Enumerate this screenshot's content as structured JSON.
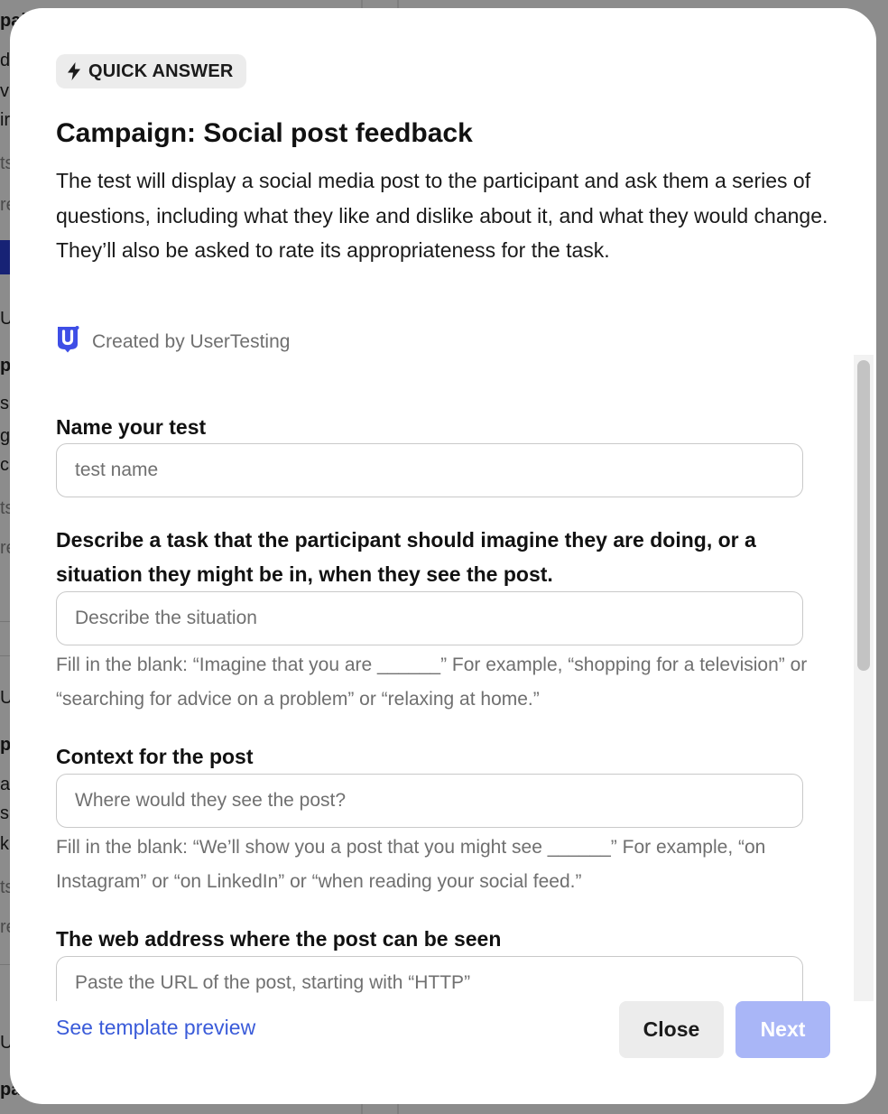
{
  "background": {
    "fragments": [
      "pai",
      "di",
      "v",
      "ir",
      "ts",
      "re",
      "U",
      "p",
      "sh",
      "g",
      "c",
      "ts",
      "re",
      "U",
      "p",
      "a",
      "sk",
      "k",
      "ts",
      "re",
      "U",
      "pa"
    ]
  },
  "modal": {
    "badge": {
      "icon": "lightning-bolt-icon",
      "label": "QUICK ANSWER"
    },
    "title": "Campaign: Social post feedback",
    "description": "The test will display a social media post to the participant and ask them a series of questions, including what they like and dislike about it, and what they would change. They’ll also be asked to rate its appropriateness for the task.",
    "creator": {
      "logo": "usertesting-logo-icon",
      "text": "Created by UserTesting"
    },
    "form": {
      "name_label": "Name your test",
      "name_placeholder": "test name",
      "task_label": "Describe a task that the participant should imagine they are doing, or a situation they might be in, when they see the post.",
      "task_placeholder": "Describe the situation",
      "task_help": "Fill in the blank: “Imagine that you are ______” For example, “shopping for a television” or “searching for advice on a problem” or “relaxing at home.”",
      "context_label": "Context for the post",
      "context_placeholder": "Where would they see the post?",
      "context_help": "Fill in the blank: “We’ll show you a post that you might see ______” For example, “on Instagram” or “on LinkedIn” or “when reading your social feed.”",
      "url_label": "The web address where the post can be seen",
      "url_placeholder": "Paste the URL of the post, starting with “HTTP”"
    },
    "footer": {
      "preview_link": "See template preview",
      "close_button": "Close",
      "next_button": "Next"
    }
  },
  "colors": {
    "accent_link": "#3a5bd9",
    "next_disabled": "#a9b6f7",
    "brand_logo": "#3e4ee6"
  }
}
